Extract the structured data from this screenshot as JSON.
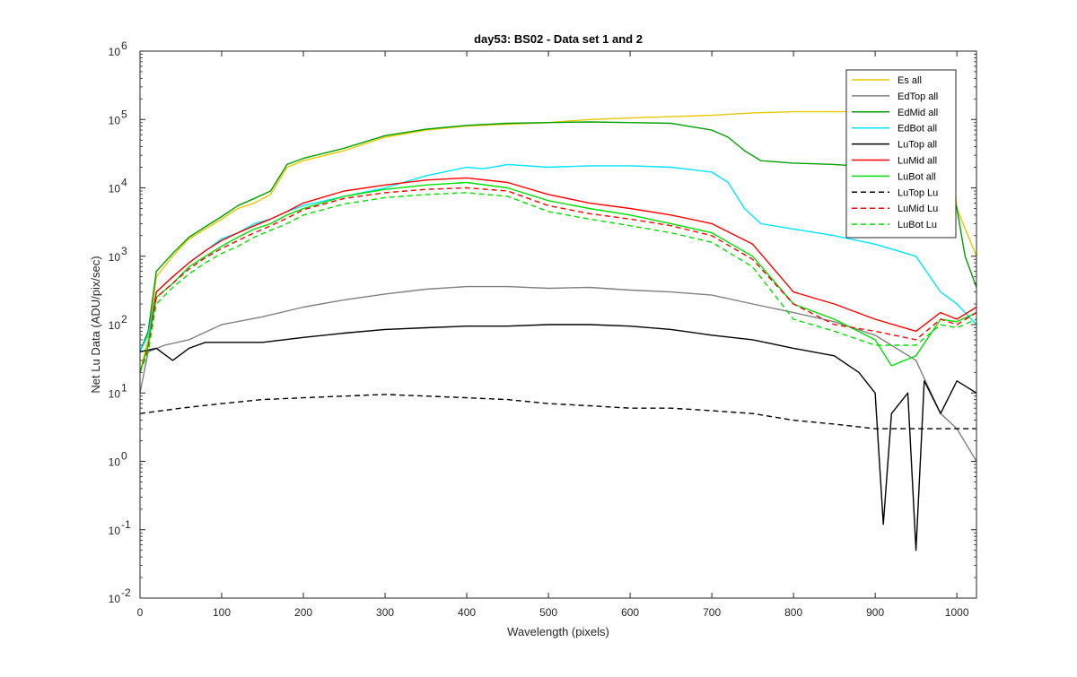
{
  "chart_data": {
    "type": "line",
    "title": "day53: BS02 - Data set 1 and 2",
    "xlabel": "Wavelength (pixels)",
    "ylabel": "Net Lu Data (ADU/pix/sec)",
    "xlim": [
      0,
      1024
    ],
    "ylim": [
      0.01,
      1000000
    ],
    "yscale": "log",
    "grid": false,
    "legend_position": "top-right",
    "x_ticks": [
      0,
      100,
      200,
      300,
      400,
      500,
      600,
      700,
      800,
      900,
      1000
    ],
    "y_ticks": [
      {
        "base": "10",
        "exp": "-2",
        "value": 0.01
      },
      {
        "base": "10",
        "exp": "-1",
        "value": 0.1
      },
      {
        "base": "10",
        "exp": "0",
        "value": 1
      },
      {
        "base": "10",
        "exp": "1",
        "value": 10
      },
      {
        "base": "10",
        "exp": "2",
        "value": 100
      },
      {
        "base": "10",
        "exp": "3",
        "value": 1000
      },
      {
        "base": "10",
        "exp": "4",
        "value": 10000
      },
      {
        "base": "10",
        "exp": "5",
        "value": 100000
      },
      {
        "base": "10",
        "exp": "6",
        "value": 1000000
      }
    ],
    "series": [
      {
        "name": "Es  all",
        "color": "#e6c800",
        "dash": "solid",
        "points": [
          [
            0,
            20
          ],
          [
            10,
            60
          ],
          [
            20,
            500
          ],
          [
            40,
            1000
          ],
          [
            60,
            1800
          ],
          [
            80,
            2500
          ],
          [
            100,
            3500
          ],
          [
            120,
            5000
          ],
          [
            140,
            6000
          ],
          [
            160,
            8000
          ],
          [
            180,
            20000
          ],
          [
            200,
            25000
          ],
          [
            250,
            35000
          ],
          [
            300,
            55000
          ],
          [
            350,
            70000
          ],
          [
            400,
            80000
          ],
          [
            450,
            85000
          ],
          [
            500,
            90000
          ],
          [
            550,
            100000
          ],
          [
            600,
            105000
          ],
          [
            650,
            110000
          ],
          [
            700,
            115000
          ],
          [
            750,
            125000
          ],
          [
            800,
            130000
          ],
          [
            850,
            130000
          ],
          [
            900,
            130000
          ],
          [
            950,
            130000
          ],
          [
            990,
            100000
          ],
          [
            1000,
            5000
          ],
          [
            1024,
            1000
          ]
        ]
      },
      {
        "name": "EdTop  all",
        "color": "#808080",
        "dash": "solid",
        "points": [
          [
            0,
            10
          ],
          [
            10,
            40
          ],
          [
            30,
            50
          ],
          [
            60,
            60
          ],
          [
            100,
            100
          ],
          [
            150,
            130
          ],
          [
            200,
            180
          ],
          [
            250,
            230
          ],
          [
            300,
            280
          ],
          [
            350,
            330
          ],
          [
            400,
            360
          ],
          [
            450,
            360
          ],
          [
            500,
            340
          ],
          [
            550,
            350
          ],
          [
            600,
            320
          ],
          [
            650,
            300
          ],
          [
            700,
            270
          ],
          [
            750,
            200
          ],
          [
            800,
            150
          ],
          [
            850,
            110
          ],
          [
            900,
            70
          ],
          [
            950,
            30
          ],
          [
            980,
            5
          ],
          [
            1000,
            3
          ],
          [
            1024,
            1
          ]
        ]
      },
      {
        "name": "EdMid  all",
        "color": "#00a000",
        "dash": "solid",
        "points": [
          [
            0,
            40
          ],
          [
            10,
            80
          ],
          [
            20,
            600
          ],
          [
            40,
            1100
          ],
          [
            60,
            1900
          ],
          [
            80,
            2700
          ],
          [
            100,
            3800
          ],
          [
            120,
            5500
          ],
          [
            140,
            7000
          ],
          [
            160,
            9000
          ],
          [
            180,
            22000
          ],
          [
            200,
            27000
          ],
          [
            250,
            38000
          ],
          [
            300,
            58000
          ],
          [
            350,
            72000
          ],
          [
            400,
            82000
          ],
          [
            450,
            88000
          ],
          [
            500,
            90000
          ],
          [
            550,
            92000
          ],
          [
            600,
            90000
          ],
          [
            650,
            88000
          ],
          [
            700,
            70000
          ],
          [
            720,
            55000
          ],
          [
            740,
            35000
          ],
          [
            760,
            25000
          ],
          [
            800,
            23000
          ],
          [
            850,
            22000
          ],
          [
            900,
            20000
          ],
          [
            950,
            18000
          ],
          [
            990,
            15000
          ],
          [
            1000,
            5000
          ],
          [
            1010,
            1000
          ],
          [
            1024,
            350
          ]
        ]
      },
      {
        "name": "EdBot  all",
        "color": "#00e5ff",
        "dash": "solid",
        "points": [
          [
            0,
            40
          ],
          [
            10,
            70
          ],
          [
            20,
            300
          ],
          [
            40,
            500
          ],
          [
            60,
            800
          ],
          [
            80,
            1200
          ],
          [
            100,
            1800
          ],
          [
            120,
            2200
          ],
          [
            140,
            3000
          ],
          [
            160,
            3500
          ],
          [
            180,
            4500
          ],
          [
            200,
            5500
          ],
          [
            250,
            7500
          ],
          [
            300,
            10000
          ],
          [
            350,
            15000
          ],
          [
            400,
            20000
          ],
          [
            420,
            19000
          ],
          [
            450,
            22000
          ],
          [
            500,
            20000
          ],
          [
            550,
            21000
          ],
          [
            600,
            21000
          ],
          [
            650,
            20000
          ],
          [
            700,
            17000
          ],
          [
            720,
            12000
          ],
          [
            740,
            5000
          ],
          [
            760,
            3000
          ],
          [
            800,
            2500
          ],
          [
            850,
            2000
          ],
          [
            900,
            1500
          ],
          [
            950,
            1000
          ],
          [
            980,
            300
          ],
          [
            1000,
            200
          ],
          [
            1024,
            100
          ]
        ]
      },
      {
        "name": "LuTop  all",
        "color": "#000000",
        "dash": "solid",
        "points": [
          [
            0,
            40
          ],
          [
            20,
            45
          ],
          [
            40,
            30
          ],
          [
            60,
            45
          ],
          [
            80,
            55
          ],
          [
            100,
            55
          ],
          [
            150,
            55
          ],
          [
            200,
            65
          ],
          [
            250,
            75
          ],
          [
            300,
            85
          ],
          [
            350,
            90
          ],
          [
            400,
            95
          ],
          [
            450,
            95
          ],
          [
            500,
            100
          ],
          [
            550,
            100
          ],
          [
            600,
            95
          ],
          [
            650,
            85
          ],
          [
            700,
            70
          ],
          [
            750,
            60
          ],
          [
            800,
            45
          ],
          [
            850,
            35
          ],
          [
            880,
            20
          ],
          [
            900,
            10
          ],
          [
            910,
            0.12
          ],
          [
            920,
            5
          ],
          [
            940,
            10
          ],
          [
            950,
            0.05
          ],
          [
            960,
            15
          ],
          [
            980,
            5
          ],
          [
            1000,
            15
          ],
          [
            1024,
            10
          ]
        ]
      },
      {
        "name": "LuMid  all",
        "color": "#ff0000",
        "dash": "solid",
        "points": [
          [
            0,
            20
          ],
          [
            10,
            50
          ],
          [
            20,
            300
          ],
          [
            40,
            500
          ],
          [
            60,
            800
          ],
          [
            80,
            1200
          ],
          [
            100,
            1700
          ],
          [
            120,
            2200
          ],
          [
            140,
            2800
          ],
          [
            160,
            3500
          ],
          [
            180,
            4500
          ],
          [
            200,
            6000
          ],
          [
            250,
            9000
          ],
          [
            300,
            11000
          ],
          [
            350,
            13000
          ],
          [
            400,
            14000
          ],
          [
            450,
            12000
          ],
          [
            500,
            8000
          ],
          [
            550,
            6000
          ],
          [
            600,
            5000
          ],
          [
            650,
            4000
          ],
          [
            700,
            3000
          ],
          [
            750,
            1500
          ],
          [
            800,
            300
          ],
          [
            850,
            200
          ],
          [
            900,
            120
          ],
          [
            950,
            80
          ],
          [
            980,
            150
          ],
          [
            1000,
            120
          ],
          [
            1024,
            180
          ]
        ]
      },
      {
        "name": "LuBot  all",
        "color": "#00e000",
        "dash": "solid",
        "points": [
          [
            0,
            20
          ],
          [
            10,
            50
          ],
          [
            20,
            250
          ],
          [
            40,
            400
          ],
          [
            60,
            700
          ],
          [
            80,
            1000
          ],
          [
            100,
            1400
          ],
          [
            120,
            1900
          ],
          [
            140,
            2500
          ],
          [
            160,
            3000
          ],
          [
            180,
            4000
          ],
          [
            200,
            5000
          ],
          [
            250,
            7500
          ],
          [
            300,
            9500
          ],
          [
            350,
            11000
          ],
          [
            400,
            12000
          ],
          [
            450,
            10000
          ],
          [
            500,
            6500
          ],
          [
            550,
            5000
          ],
          [
            600,
            4000
          ],
          [
            650,
            3000
          ],
          [
            700,
            2200
          ],
          [
            750,
            1000
          ],
          [
            800,
            200
          ],
          [
            850,
            120
          ],
          [
            900,
            60
          ],
          [
            920,
            25
          ],
          [
            950,
            35
          ],
          [
            980,
            120
          ],
          [
            1000,
            110
          ],
          [
            1024,
            150
          ]
        ]
      },
      {
        "name": "LuTop  Lu",
        "color": "#000000",
        "dash": "dashed",
        "points": [
          [
            0,
            5
          ],
          [
            50,
            6
          ],
          [
            100,
            7
          ],
          [
            150,
            8
          ],
          [
            200,
            8.5
          ],
          [
            250,
            9
          ],
          [
            300,
            9.5
          ],
          [
            350,
            9
          ],
          [
            400,
            8.5
          ],
          [
            450,
            8
          ],
          [
            500,
            7
          ],
          [
            550,
            6.5
          ],
          [
            600,
            6
          ],
          [
            650,
            6
          ],
          [
            700,
            5.5
          ],
          [
            750,
            5
          ],
          [
            800,
            4
          ],
          [
            850,
            3.5
          ],
          [
            900,
            3
          ],
          [
            950,
            3
          ],
          [
            1000,
            3
          ],
          [
            1024,
            3
          ]
        ]
      },
      {
        "name": "LuMid  Lu",
        "color": "#ff0000",
        "dash": "dashed",
        "points": [
          [
            0,
            20
          ],
          [
            10,
            45
          ],
          [
            20,
            250
          ],
          [
            40,
            400
          ],
          [
            60,
            650
          ],
          [
            80,
            950
          ],
          [
            100,
            1300
          ],
          [
            120,
            1700
          ],
          [
            140,
            2200
          ],
          [
            160,
            2800
          ],
          [
            180,
            3600
          ],
          [
            200,
            4800
          ],
          [
            250,
            7000
          ],
          [
            300,
            8500
          ],
          [
            350,
            9500
          ],
          [
            400,
            10000
          ],
          [
            450,
            9000
          ],
          [
            500,
            5500
          ],
          [
            550,
            4200
          ],
          [
            600,
            3500
          ],
          [
            650,
            2800
          ],
          [
            700,
            2000
          ],
          [
            750,
            900
          ],
          [
            800,
            200
          ],
          [
            850,
            100
          ],
          [
            900,
            80
          ],
          [
            950,
            60
          ],
          [
            980,
            120
          ],
          [
            1000,
            100
          ],
          [
            1024,
            150
          ]
        ]
      },
      {
        "name": "LuBot  Lu",
        "color": "#00e000",
        "dash": "dashed",
        "points": [
          [
            0,
            20
          ],
          [
            10,
            40
          ],
          [
            20,
            200
          ],
          [
            40,
            350
          ],
          [
            60,
            550
          ],
          [
            80,
            800
          ],
          [
            100,
            1100
          ],
          [
            120,
            1400
          ],
          [
            140,
            1900
          ],
          [
            160,
            2400
          ],
          [
            180,
            3000
          ],
          [
            200,
            4000
          ],
          [
            250,
            5800
          ],
          [
            300,
            7200
          ],
          [
            350,
            8000
          ],
          [
            400,
            8500
          ],
          [
            450,
            7500
          ],
          [
            500,
            4500
          ],
          [
            550,
            3500
          ],
          [
            600,
            2800
          ],
          [
            650,
            2200
          ],
          [
            700,
            1600
          ],
          [
            750,
            700
          ],
          [
            800,
            120
          ],
          [
            850,
            80
          ],
          [
            900,
            50
          ],
          [
            950,
            50
          ],
          [
            980,
            100
          ],
          [
            1000,
            90
          ],
          [
            1024,
            120
          ]
        ]
      }
    ]
  }
}
